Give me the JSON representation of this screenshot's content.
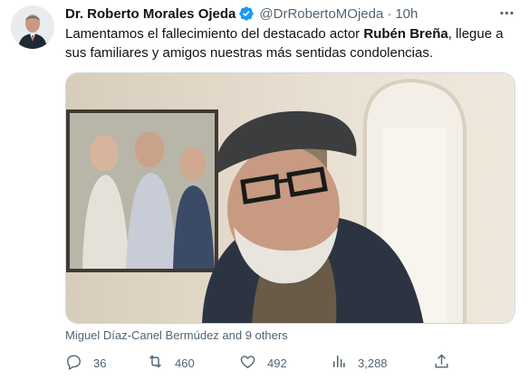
{
  "author": {
    "name": "Dr. Roberto Morales Ojeda",
    "handle": "@DrRobertoMOjeda",
    "separator": "·",
    "time": "10h"
  },
  "tweet": {
    "text_part1": "Lamentamos el fallecimiento del destacado actor ",
    "text_bold": "Rubén Breña",
    "text_part2": ", llegue a sus familiares y amigos nuestras más sentidas condolencias."
  },
  "tagged": "Miguel Díaz-Canel Bermúdez and 9 others",
  "actions": {
    "replies": "36",
    "retweets": "460",
    "likes": "492",
    "views": "3,288"
  },
  "colors": {
    "verified": "#1d9bf0",
    "secondary_text": "#536471",
    "primary_text": "#0f1419"
  },
  "icons": [
    "verified-badge-icon",
    "more-icon",
    "reply-icon",
    "retweet-icon",
    "like-icon",
    "views-icon",
    "share-icon"
  ]
}
